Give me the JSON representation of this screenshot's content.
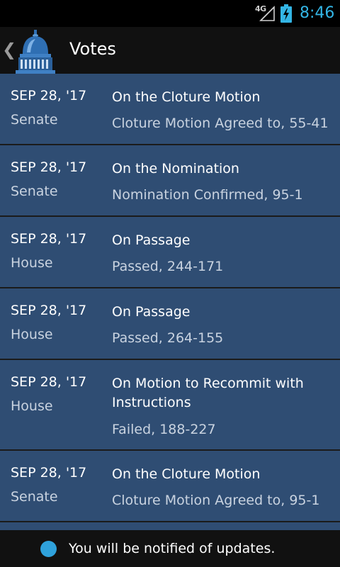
{
  "status_bar": {
    "network": "4G",
    "clock": "8:46",
    "accent_color": "#33b5e5"
  },
  "action_bar": {
    "title": "Votes",
    "up_icon": "chevron-left-icon",
    "app_icon": "capitol-dome-icon"
  },
  "votes": [
    {
      "date": "SEP 28, '17",
      "chamber": "Senate",
      "question": "On the Cloture Motion",
      "result": "Cloture Motion Agreed to, 55-41"
    },
    {
      "date": "SEP 28, '17",
      "chamber": "Senate",
      "question": "On the Nomination",
      "result": "Nomination Confirmed, 95-1"
    },
    {
      "date": "SEP 28, '17",
      "chamber": "House",
      "question": "On Passage",
      "result": "Passed, 244-171"
    },
    {
      "date": "SEP 28, '17",
      "chamber": "House",
      "question": "On Passage",
      "result": "Passed, 264-155"
    },
    {
      "date": "SEP 28, '17",
      "chamber": "House",
      "question": "On Motion to Recommit with Instructions",
      "result": "Failed, 188-227"
    },
    {
      "date": "SEP 28, '17",
      "chamber": "Senate",
      "question": "On the Cloture Motion",
      "result": "Cloture Motion Agreed to, 95-1"
    },
    {
      "date": "",
      "chamber": "",
      "question": "",
      "result": ""
    }
  ],
  "notification": {
    "text": "You will be notified of updates.",
    "indicator_color": "#2fa2dc"
  },
  "colors": {
    "row_background": "#2f4d73",
    "divider": "#1b1b1b"
  }
}
